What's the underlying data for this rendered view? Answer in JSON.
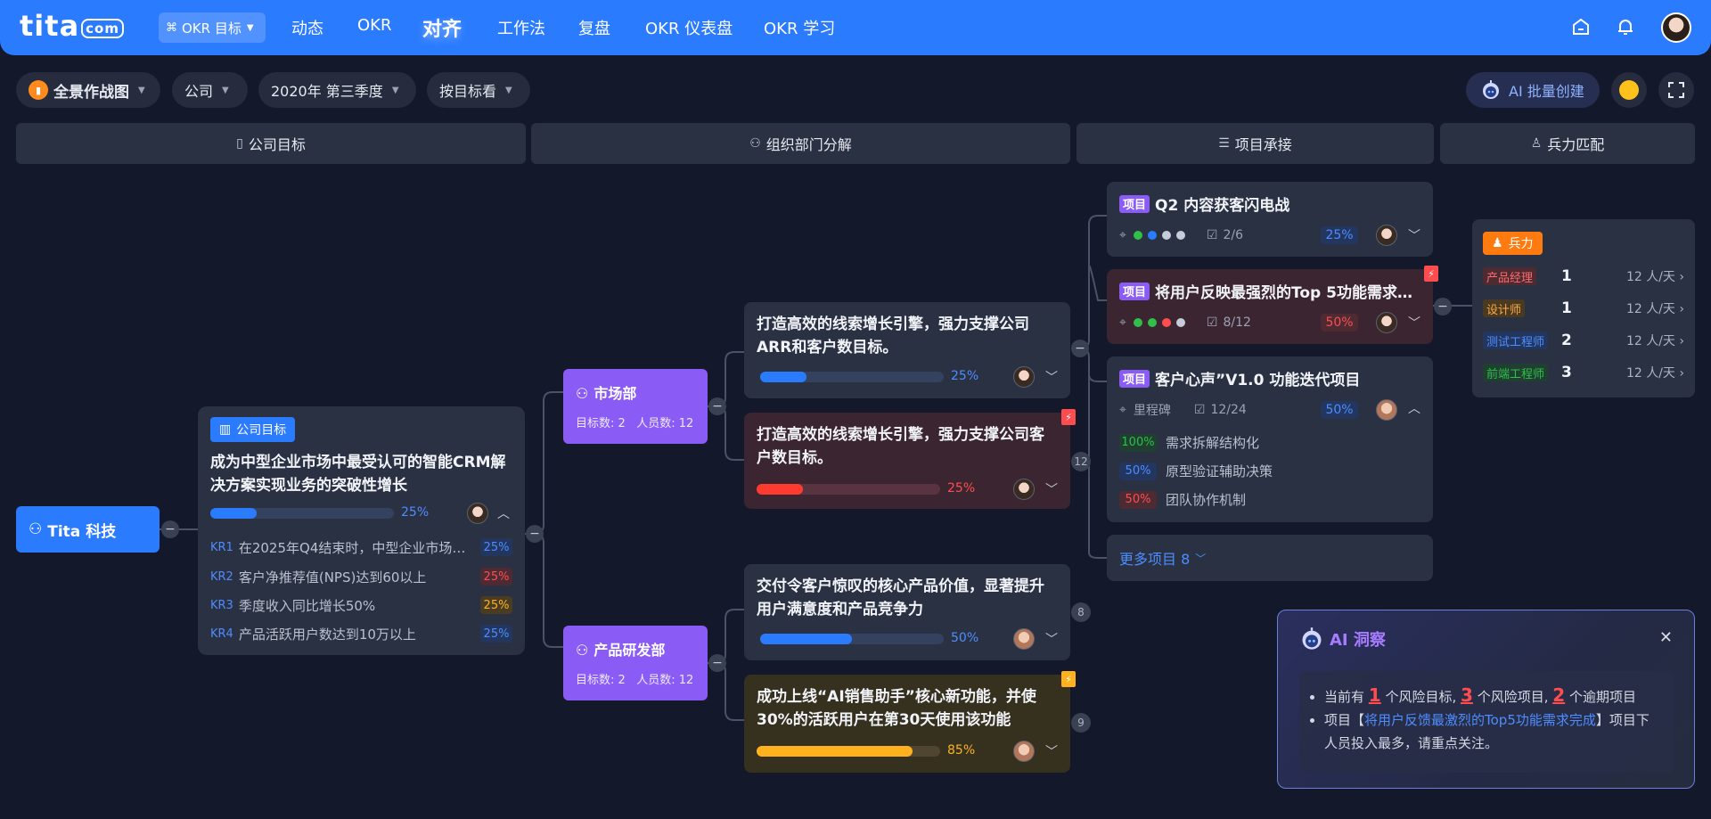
{
  "topbar": {
    "logo_text": "tita",
    "logo_suffix": "com",
    "okr_select_label": "OKR 目标",
    "nav": [
      "动态",
      "OKR",
      "对齐",
      "工作法",
      "复盘",
      "OKR 仪表盘",
      "OKR 学习"
    ],
    "active_nav": "对齐"
  },
  "filters": {
    "view": "全景作战图",
    "scope": "公司",
    "period": "2020年 第三季度",
    "mode": "按目标看",
    "ai_create": "AI 批量创建"
  },
  "sections": [
    "公司目标",
    "组织部门分解",
    "项目承接",
    "兵力匹配"
  ],
  "root": {
    "name": "Tita 科技"
  },
  "company_goal": {
    "badge": "公司目标",
    "title": "成为中型企业市场中最受认可的智能CRM解决方案实现业务的突破性增长",
    "progress": 25,
    "progress_label": "25%",
    "krs": [
      {
        "code": "KR1",
        "text": "在2025年Q4结束时，中型企业市场…",
        "pct": "25%",
        "status": "blue"
      },
      {
        "code": "KR2",
        "text": "客户净推荐值(NPS)达到60以上",
        "pct": "25%",
        "status": "red"
      },
      {
        "code": "KR3",
        "text": "季度收入同比增长50%",
        "pct": "25%",
        "status": "yellow"
      },
      {
        "code": "KR4",
        "text": "产品活跃用户数达到10万以上",
        "pct": "25%",
        "status": "blue"
      }
    ]
  },
  "departments": [
    {
      "name": "市场部",
      "goals_label": "目标数: 2",
      "members_label": "人员数: 12"
    },
    {
      "name": "产品研发部",
      "goals_label": "目标数: 2",
      "members_label": "人员数: 12"
    }
  ],
  "objectives": [
    {
      "title": "打造高效的线索增长引擎，强力支撑公司ARR和客户数目标。",
      "progress": 25,
      "pct": "25%",
      "status": "normal"
    },
    {
      "title": "打造高效的线索增长引擎，强力支撑公司客户数目标。",
      "progress": 25,
      "pct": "25%",
      "status": "risk",
      "count": "12"
    },
    {
      "title": "交付令客户惊叹的核心产品价值，显著提升用户满意度和产品竞争力",
      "progress": 50,
      "pct": "50%",
      "status": "normal",
      "count": "8"
    },
    {
      "title": "成功上线“AI销售助手”核心新功能，并使30%的活跃用户在第30天使用该功能",
      "progress": 85,
      "pct": "85%",
      "status": "warning",
      "count": "9"
    }
  ],
  "projects": [
    {
      "tag": "项目",
      "title": "Q2 内容获客闪电战",
      "tasks": "2/6",
      "pct": "25%",
      "status": "blue",
      "dots": [
        "#2fbf4a",
        "#2b7bff",
        "#c6ccda",
        "#c6ccda"
      ]
    },
    {
      "tag": "项目",
      "title": "将用户反映最强烈的Top 5功能需求…",
      "tasks": "8/12",
      "pct": "50%",
      "status": "red",
      "dots": [
        "#2fbf4a",
        "#2fbf4a",
        "#ff4d4f",
        "#c6ccda"
      ]
    },
    {
      "tag": "项目",
      "title": "客户心声”V1.0 功能迭代项目",
      "milestone": "里程碑",
      "tasks": "12/24",
      "pct": "50%",
      "status": "blue",
      "subs": [
        {
          "pct": "100%",
          "text": "需求拆解结构化",
          "status": "green"
        },
        {
          "pct": "50%",
          "text": "原型验证辅助决策",
          "status": "blue"
        },
        {
          "pct": "50%",
          "text": "团队协作机制",
          "status": "red"
        }
      ]
    }
  ],
  "more_projects": "更多项目 8",
  "force": {
    "badge": "兵力",
    "rows": [
      {
        "role": "产品经理",
        "count": "1",
        "rate": "12 人/天",
        "color": "red"
      },
      {
        "role": "设计师",
        "count": "1",
        "rate": "12 人/天",
        "color": "orange"
      },
      {
        "role": "测试工程师",
        "count": "2",
        "rate": "12 人/天",
        "color": "blue"
      },
      {
        "role": "前端工程师",
        "count": "3",
        "rate": "12 人/天",
        "color": "green"
      }
    ]
  },
  "ai_insight": {
    "title": "AI 洞察",
    "line1_a": "当前有 ",
    "risk_goals": "1",
    "line1_b": " 个风险目标, ",
    "risk_projects": "3",
    "line1_c": " 个风险项目, ",
    "overdue": "2",
    "line1_d": " 个逾期项目",
    "line2_a": "项目【",
    "line2_link": "将用户反馈最激烈的Top5功能需求完成",
    "line2_b": "】项目下人员投入最多，请重点关注。"
  },
  "colors": {
    "brand_blue": "#2b7bff",
    "dept_purple": "#8a5cf5",
    "risk_red": "#ff4d4f",
    "warn_yellow": "#ffb21d",
    "force_orange": "#ff7a0f"
  }
}
